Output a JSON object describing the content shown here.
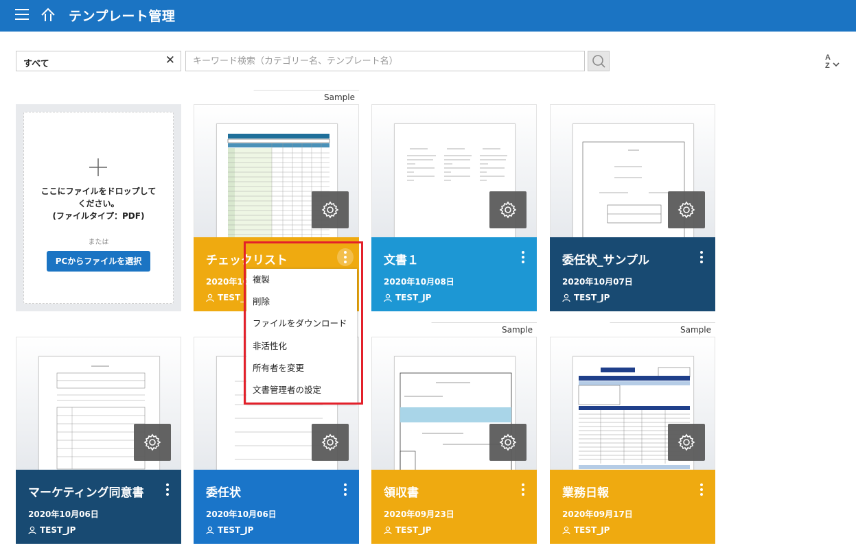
{
  "header": {
    "title": "テンプレート管理"
  },
  "toolbar": {
    "filter_value": "すべて",
    "clear_symbol": "✕",
    "search_placeholder": "キーワード検索（カテゴリー名、テンプレート名）",
    "sort_top": "A",
    "sort_bottom": "Z"
  },
  "upload": {
    "drop_line1": "ここにファイルをドロップして",
    "drop_line2": "ください。",
    "drop_line3": "(ファイルタイプ：PDF)",
    "or": "または",
    "button": "PCからファイルを選択"
  },
  "sample_label": "Sample",
  "cards": [
    {
      "title": "チェックリスト",
      "date": "2020年10月08日",
      "owner": "TEST_JP",
      "color": "#efaa10",
      "sample": true
    },
    {
      "title": "文書１",
      "date": "2020年10月08日",
      "owner": "TEST_JP",
      "color": "#1d97d4",
      "sample": false
    },
    {
      "title": "委任状_サンプル",
      "date": "2020年10月07日",
      "owner": "TEST_JP",
      "color": "#184a72",
      "sample": false
    },
    {
      "title": "マーケティング同意書",
      "date": "2020年10月06日",
      "owner": "TEST_JP",
      "color": "#184a72",
      "sample": false
    },
    {
      "title": "委任状",
      "date": "2020年10月06日",
      "owner": "TEST_JP",
      "color": "#1a75c9",
      "sample": false
    },
    {
      "title": "領収書",
      "date": "2020年09月23日",
      "owner": "TEST_JP",
      "color": "#efaa10",
      "sample": true
    },
    {
      "title": "業務日報",
      "date": "2020年09月17日",
      "owner": "TEST_JP",
      "color": "#efaa10",
      "sample": true
    }
  ],
  "first_card_date_visible": "2020年10",
  "first_card_owner_visible": "TEST_",
  "first_card_title_visible": "チェックリスト",
  "context_menu": [
    {
      "label": "複製"
    },
    {
      "label": "削除"
    },
    {
      "label": "ファイルをダウンロード"
    },
    {
      "label": "非活性化"
    },
    {
      "label": "所有者を変更"
    },
    {
      "label": "文書管理者の設定"
    }
  ],
  "icons": [
    "menu-icon",
    "home-icon",
    "search-icon",
    "sort-icon",
    "plus-icon",
    "gear-icon",
    "more-vertical-icon",
    "user-icon"
  ]
}
